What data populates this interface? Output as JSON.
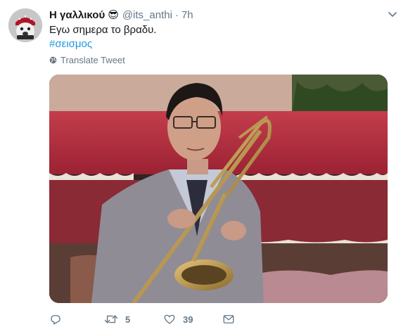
{
  "tweet": {
    "author_name": "Η γαλλικού",
    "author_emoji": "😎",
    "handle": "@its_anthi",
    "separator": "·",
    "time": "7h",
    "text": "Εγω σημερα το βραδυ.",
    "hashtag": "#σεισμος",
    "translate_label": "Translate Tweet"
  },
  "actions": {
    "retweet_count": "5",
    "like_count": "39"
  },
  "icons": {
    "chevron": "chevron-down-icon",
    "globe": "globe-icon",
    "reply": "reply-icon",
    "retweet": "retweet-icon",
    "like": "heart-icon",
    "dm": "envelope-icon"
  },
  "colors": {
    "link": "#1b95e0",
    "secondary_text": "#657786",
    "primary_text": "#14171a"
  }
}
